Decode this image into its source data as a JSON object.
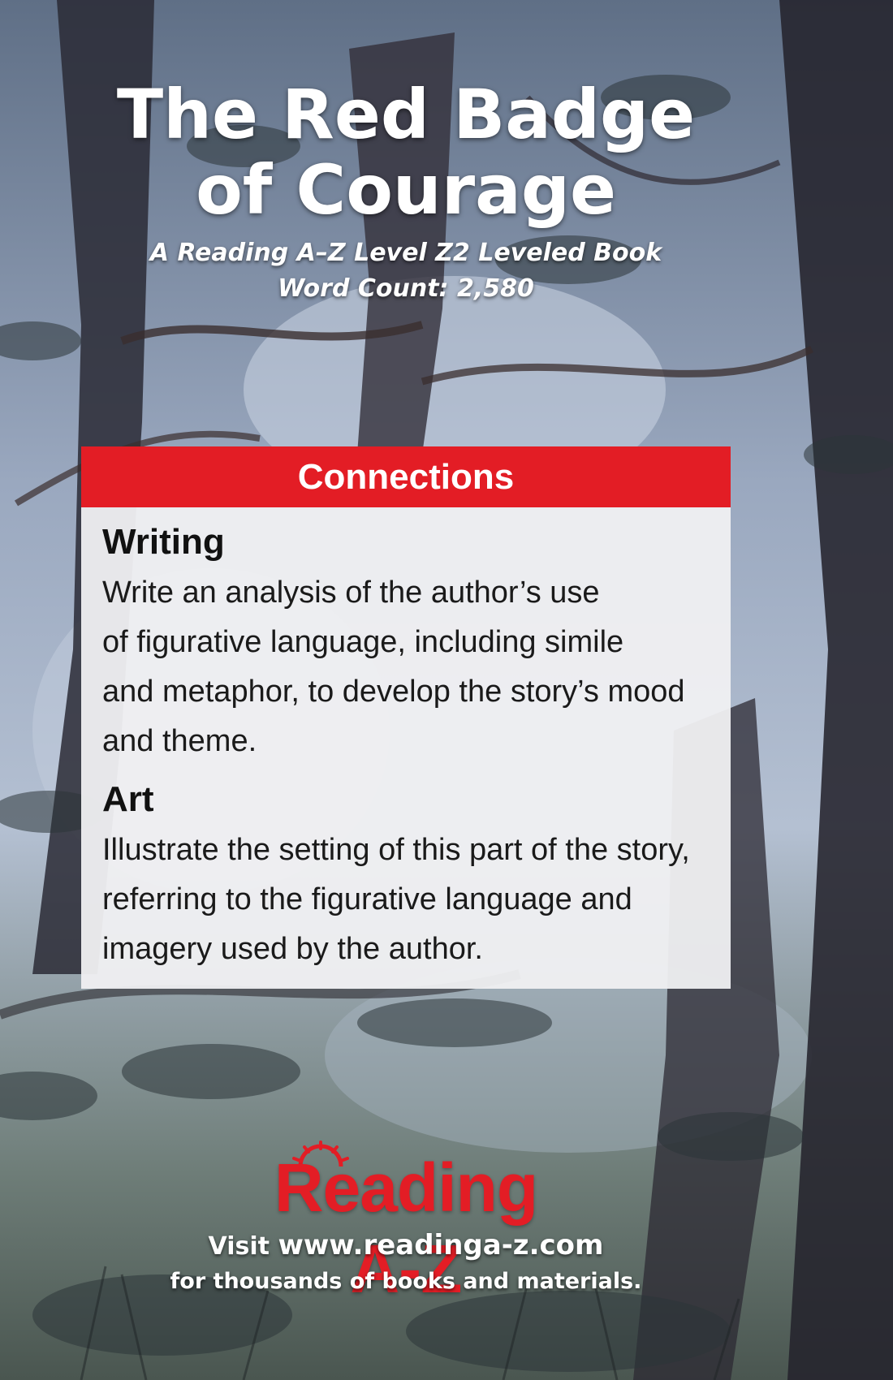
{
  "cover": {
    "title_line1": "The Red Badge",
    "title_line2": "of Courage",
    "subtitle_line1": "A Reading A–Z Level Z2 Leveled Book",
    "subtitle_line2": "Word Count: 2,580"
  },
  "panel": {
    "header": "Connections",
    "sections": [
      {
        "title": "Writing",
        "lines": [
          "Write an analysis of the author’s use",
          "of figurative language, including simile",
          "and metaphor, to develop the story’s mood",
          "and theme."
        ]
      },
      {
        "title": "Art",
        "lines": [
          "Illustrate the setting of this part of the story,",
          "referring to the figurative language and",
          "imagery used by the author."
        ]
      }
    ]
  },
  "footer": {
    "logo": "Reading A-Z",
    "visit_prefix": "Visit",
    "url": "www.readinga-z.com",
    "tagline": "for thousands of books and materials."
  },
  "colors": {
    "header_red": "#e31d25",
    "logo_red": "#e31d25",
    "panel_bg": "#f0f0f2"
  }
}
